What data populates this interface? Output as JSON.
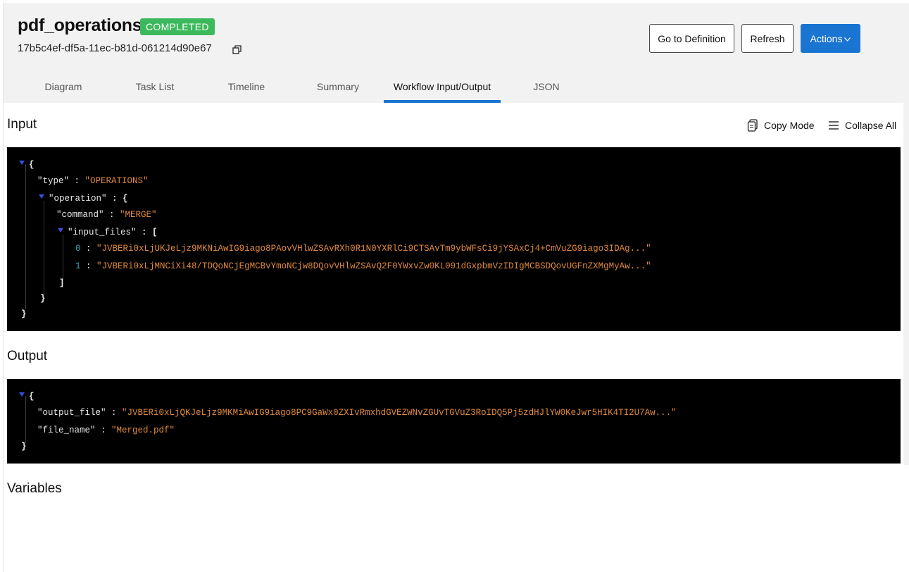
{
  "header": {
    "title": "pdf_operations",
    "status": "COMPLETED",
    "workflow_id": "17b5c4ef-df5a-11ec-b81d-061214d90e67",
    "buttons": {
      "definition": "Go to Definition",
      "refresh": "Refresh",
      "actions": "Actions"
    }
  },
  "tabs": [
    {
      "label": "Diagram"
    },
    {
      "label": "Task List"
    },
    {
      "label": "Timeline"
    },
    {
      "label": "Summary"
    },
    {
      "label": "Workflow Input/Output"
    },
    {
      "label": "JSON"
    }
  ],
  "active_tab": "Workflow Input/Output",
  "input": {
    "title": "Input",
    "copy_mode": "Copy Mode",
    "collapse_all": "Collapse All",
    "json": {
      "type_key": "\"type\"",
      "type_val": "\"OPERATIONS\"",
      "operation_key": "\"operation\"",
      "command_key": "\"command\"",
      "command_val": "\"MERGE\"",
      "input_files_key": "\"input_files\"",
      "file0_idx": "0",
      "file0_val": "\"JVBERi0xLjUKJeLjz9MKNiAwIG9iago8PAovVHlwZSAvRXh0R1N0YXRlCi9CTSAvTm9ybWFsCi9jYSAxCj4+CmVuZG9iago3IDAg...\"",
      "file1_idx": "1",
      "file1_val": "\"JVBERi0xLjMNCiXi48/TDQoNCjEgMCBvYmoNCjw8DQovVHlwZSAvQ2F0YWxvZw0KL091dGxpbmVzIDIgMCBSDQovUGFnZXMgMyAw...\""
    }
  },
  "output": {
    "title": "Output",
    "json": {
      "output_file_key": "\"output_file\"",
      "output_file_val": "\"JVBERi0xLjQKJeLjz9MKMiAwIG9iago8PC9GaWx0ZXIvRmxhdGVEZWNvZGUvTGVuZ3RoIDQ5Pj5zdHJlYW0KeJwr5HIK4TI2U7Aw...\"",
      "file_name_key": "\"file_name\"",
      "file_name_val": "\"Merged.pdf\""
    }
  },
  "variables": {
    "title": "Variables"
  },
  "colors": {
    "accent": "#1a74d1",
    "status": "#3cb95c",
    "string": "#e08a3c",
    "index": "#3aa7b0",
    "collapse_triangle": "#3b4fe0"
  },
  "icons": [
    "copy-icon",
    "chevron-down-icon",
    "document-copy-icon",
    "menu-lines-icon",
    "collapse-triangle-icon"
  ]
}
